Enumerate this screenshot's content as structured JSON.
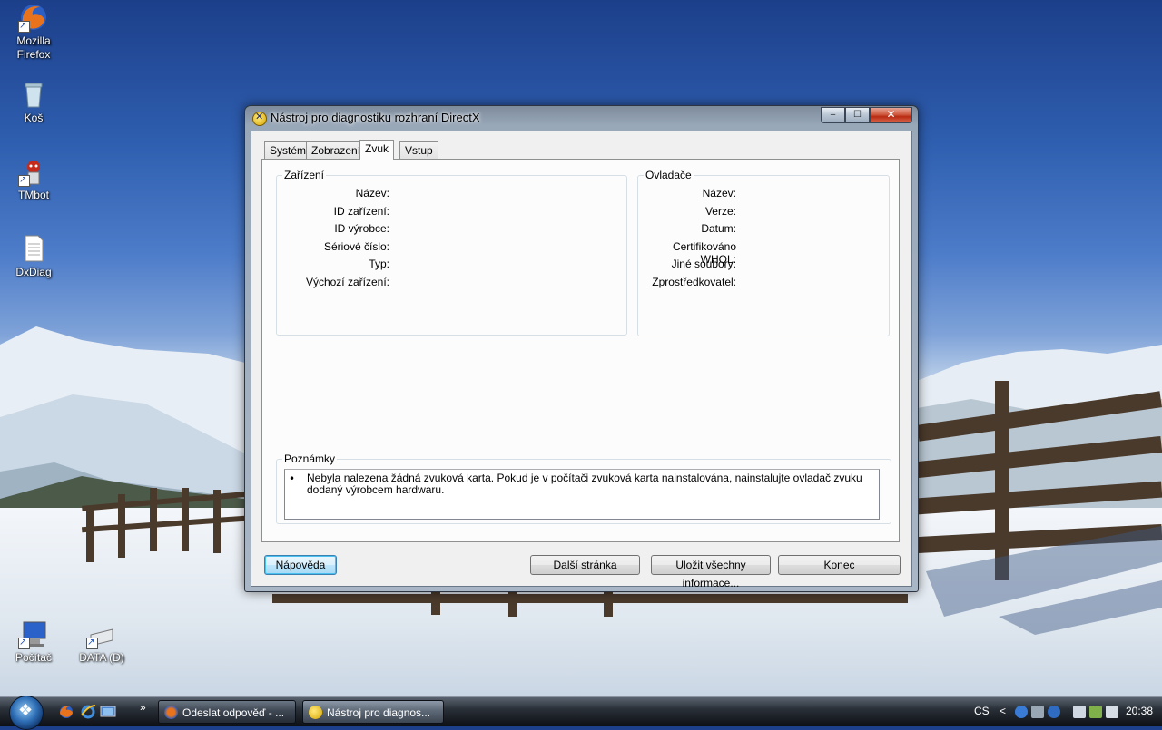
{
  "desktop": {
    "icons": [
      {
        "label_lines": [
          "Mozilla",
          "Firefox"
        ],
        "icon": "firefox-icon"
      },
      {
        "label_lines": [
          "Koš"
        ],
        "icon": "recycle-bin-icon"
      },
      {
        "label_lines": [
          "TMbot"
        ],
        "icon": "tmbot-icon"
      },
      {
        "label_lines": [
          "DxDiag"
        ],
        "icon": "document-icon"
      },
      {
        "label_lines": [
          "Počítač"
        ],
        "icon": "computer-icon"
      },
      {
        "label_lines": [
          "DATA (D)"
        ],
        "icon": "drive-icon"
      }
    ]
  },
  "window": {
    "title": "Nástroj pro diagnostiku rozhraní DirectX",
    "caption": {
      "minimize": "‒",
      "maximize": "☐",
      "close": "✕"
    },
    "tabs": [
      "Systém",
      "Zobrazení",
      "Zvuk",
      "Vstup"
    ],
    "active_tab": "Zvuk",
    "device_group": {
      "title": "Zařízení",
      "labels": [
        "Název:",
        "ID zařízení:",
        "ID výrobce:",
        "Sériové číslo:",
        "Typ:",
        "Výchozí zařízení:"
      ]
    },
    "drivers_group": {
      "title": "Ovladače",
      "labels": [
        "Název:",
        "Verze:",
        "Datum:",
        "Certifikováno WHQL:",
        "Jiné soubory:",
        "Zprostředkovatel:"
      ]
    },
    "notes": {
      "title": "Poznámky",
      "bullet": "•",
      "items": [
        "Nebyla nalezena žádná zvuková karta. Pokud je v počítači zvuková karta nainstalována, nainstalujte ovladač zvuku dodaný výrobcem hardwaru."
      ]
    },
    "buttons": {
      "help": "Nápověda",
      "next_page": "Další stránka",
      "save_all": "Uložit všechny informace...",
      "exit": "Konec"
    }
  },
  "taskbar": {
    "overflow": "»",
    "tasks": [
      {
        "label": "Odeslat odpověď - ...",
        "active": false
      },
      {
        "label": "Nástroj pro diagnos...",
        "active": true
      }
    ],
    "language": "CS",
    "tray_arrow": "<",
    "clock": "20:38"
  },
  "colors": {
    "taskbar": "#1a1f26",
    "window_frame": "#a9b6c6",
    "default_button": "#3c7fb1"
  }
}
